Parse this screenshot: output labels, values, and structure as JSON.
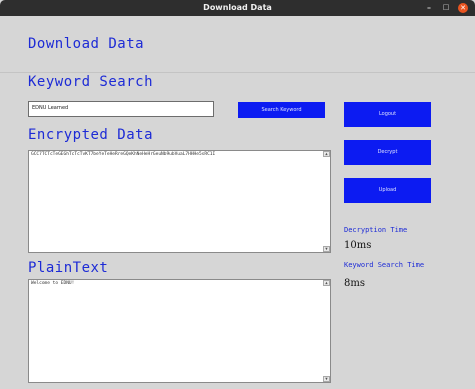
{
  "window": {
    "title": "Download Data",
    "minimize_glyph": "–",
    "maximize_glyph": "□",
    "close_glyph": "✕"
  },
  "headings": {
    "title": "Download Data",
    "keyword_search": "Keyword Search",
    "encrypted_data": "Encrypted Data",
    "plain_text": "PlainText"
  },
  "keyword_input": {
    "value": "EDNU Learned"
  },
  "buttons": {
    "search_keyword": "Search Keyword",
    "logout": "Logout",
    "decrypt": "Decrypt",
    "upload": "Upload"
  },
  "encrypted_text": "GCC7TCTcTeGEGhTcTcTvKT7beYeTeHeRreGQeKhNeHeHrGeuNb9ubVuaL7HHHe5sRC1I",
  "plain_text": "Welcome to EDNU!",
  "stats": {
    "decryption_time_label": "Decryption Time",
    "decryption_time_value": "10ms",
    "keyword_search_time_label": "Keyword Search Time",
    "keyword_search_time_value": "8ms"
  },
  "colors": {
    "accent": "#1d2bd6",
    "button_bg": "#0c1bf2",
    "titlebar_bg": "#2e2e2e",
    "close_button": "#e95420",
    "window_bg": "#d6d6d6"
  },
  "icons": {
    "scroll_up": "scroll-up-arrow-icon",
    "scroll_down": "scroll-down-arrow-icon"
  }
}
